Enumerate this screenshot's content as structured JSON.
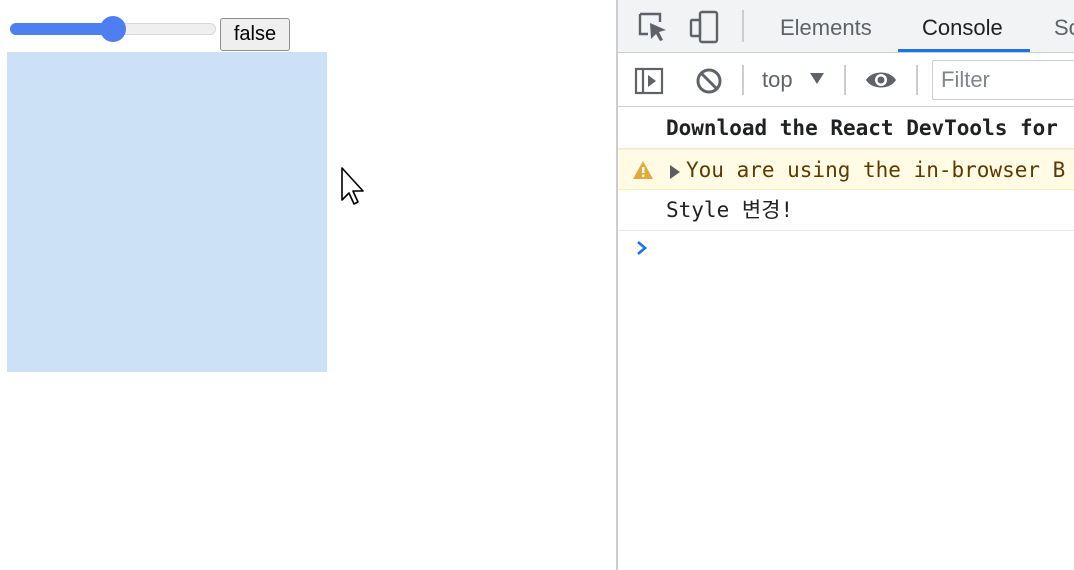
{
  "page": {
    "slider": {
      "value_fraction": 0.5
    },
    "state_button": {
      "label": "false"
    }
  },
  "devtools": {
    "tabs": [
      {
        "label": "Elements"
      },
      {
        "label": "Console"
      },
      {
        "label": "So"
      }
    ],
    "active_tab": "Console",
    "toolbar": {
      "context": "top",
      "filter_placeholder": "Filter"
    },
    "console": {
      "messages": [
        {
          "type": "info",
          "text": "Download the React DevTools for"
        },
        {
          "type": "warning",
          "text": "You are using the in-browser B"
        },
        {
          "type": "log",
          "text": "Style 변경!"
        }
      ]
    }
  },
  "colors": {
    "accent": "#4e7ff0",
    "box": "#cde1f6",
    "warning_bg": "#fffbe5",
    "tab_underline": "#1a73e8"
  },
  "icons": [
    "inspect-element-icon",
    "device-toolbar-icon",
    "sidebar-toggle-icon",
    "clear-console-icon",
    "dropdown-arrow-icon",
    "eye-icon",
    "warning-icon",
    "expand-triangle-icon",
    "console-prompt-icon",
    "mouse-cursor-icon"
  ]
}
